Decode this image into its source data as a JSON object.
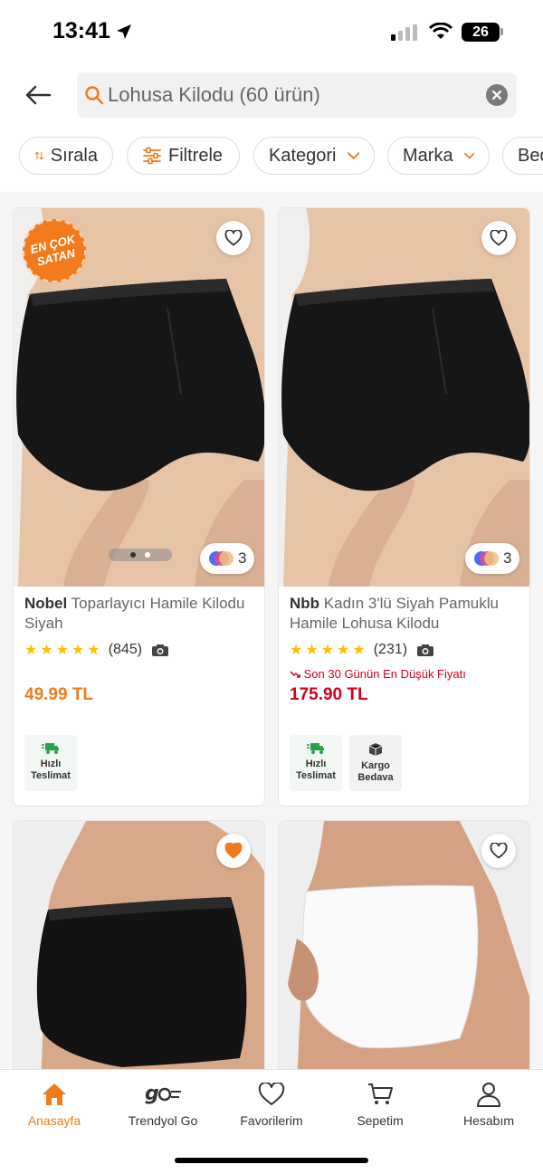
{
  "status_bar": {
    "time": "13:41",
    "battery": "26"
  },
  "search": {
    "query": "Lohusa Kilodu (60 ürün)"
  },
  "filters": {
    "sort": "Sırala",
    "filter": "Filtrele",
    "category": "Kategori",
    "brand": "Marka",
    "next": "Bed"
  },
  "products": [
    {
      "badge": [
        "EN ÇOK",
        "SATAN"
      ],
      "brand": "Nobel",
      "name": "Toparlayıcı Hamile Kilodu Siyah",
      "rating": 4.5,
      "reviews": "(845)",
      "price": "49.99 TL",
      "price_color": "#f27a1a",
      "color_count": "3",
      "favorited": false,
      "tags": [
        "Hızlı Teslimat"
      ]
    },
    {
      "brand": "Nbb",
      "name": "Kadın 3'lü Siyah Pamuklu Hamile Lohusa Kilodu",
      "rating": 4.5,
      "reviews": "(231)",
      "lowest_price_note": "Son 30 Günün En Düşük Fiyatı",
      "price": "175.90 TL",
      "price_color": "#d0021b",
      "color_count": "3",
      "favorited": false,
      "tags": [
        "Hızlı Teslimat",
        "Kargo Bedava"
      ]
    },
    {
      "favorited": true
    },
    {
      "favorited": false
    }
  ],
  "tags": {
    "fast_line1": "Hızlı",
    "fast_line2": "Teslimat",
    "cargo_line1": "Kargo",
    "cargo_line2": "Bedava"
  },
  "tabbar": {
    "home": "Anasayfa",
    "go": "Trendyol Go",
    "favorites": "Favorilerim",
    "cart": "Sepetim",
    "account": "Hesabım"
  },
  "colors": {
    "accent": "#f27a1a",
    "discount_red": "#d0021b",
    "fast_green": "#27a24a"
  }
}
